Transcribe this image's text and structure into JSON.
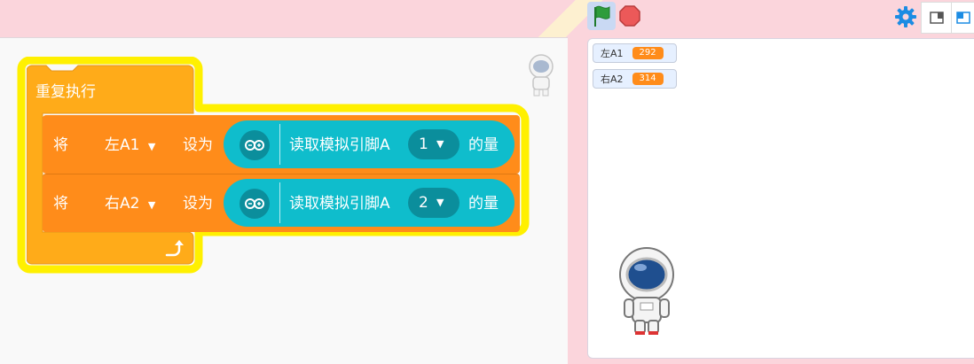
{
  "blocks": {
    "repeat_label": "重复执行",
    "rows": [
      {
        "set_label": "将",
        "variable": "左A1",
        "to_label": "设为",
        "read_label": "读取模拟引脚A",
        "pin": "1",
        "suffix": "的量"
      },
      {
        "set_label": "将",
        "variable": "右A2",
        "to_label": "设为",
        "read_label": "读取模拟引脚A",
        "pin": "2",
        "suffix": "的量"
      }
    ]
  },
  "monitors": [
    {
      "label": "左A1",
      "value": "292"
    },
    {
      "label": "右A2",
      "value": "314"
    }
  ],
  "colors": {
    "control_block": "#ffab19",
    "variable_block": "#ff8c1a",
    "arduino_block": "#0fbdcc",
    "glow": "#fff000",
    "flag": "#2e9c3c",
    "stop": "#ec5959"
  },
  "icons": [
    "green-flag-icon",
    "stop-icon",
    "gear-icon",
    "small-stage-icon",
    "large-stage-icon",
    "arduino-icon",
    "dropdown-arrow-icon",
    "loop-arrow-icon",
    "astronaut-sprite",
    "astronaut-thumbnail"
  ]
}
